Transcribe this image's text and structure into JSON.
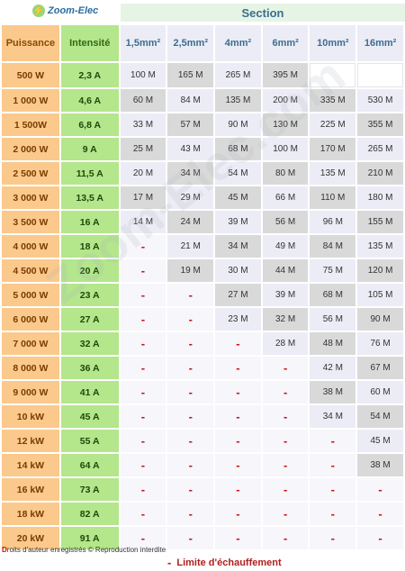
{
  "brand": {
    "logo_text": "Zoom-Elec"
  },
  "section_title": "Section",
  "headers": {
    "puissance": "Puissance",
    "intensite": "Intensité",
    "sections": [
      "1,5mm²",
      "2,5mm²",
      "4mm²",
      "6mm²",
      "10mm²",
      "16mm²"
    ]
  },
  "rows": [
    {
      "power": "500 W",
      "current": "2,3 A",
      "cells": [
        "100 M",
        "165 M",
        "265 M",
        "395 M",
        "",
        ""
      ]
    },
    {
      "power": "1 000 W",
      "current": "4,6 A",
      "cells": [
        "60 M",
        "84 M",
        "135 M",
        "200 M",
        "335 M",
        "530 M"
      ]
    },
    {
      "power": "1 500W",
      "current": "6,8 A",
      "cells": [
        "33 M",
        "57 M",
        "90 M",
        "130 M",
        "225 M",
        "355 M"
      ]
    },
    {
      "power": "2 000 W",
      "current": "9 A",
      "cells": [
        "25 M",
        "43 M",
        "68 M",
        "100 M",
        "170 M",
        "265 M"
      ]
    },
    {
      "power": "2 500 W",
      "current": "11,5 A",
      "cells": [
        "20 M",
        "34 M",
        "54 M",
        "80 M",
        "135 M",
        "210 M"
      ]
    },
    {
      "power": "3 000 W",
      "current": "13,5 A",
      "cells": [
        "17 M",
        "29 M",
        "45 M",
        "66 M",
        "110 M",
        "180 M"
      ]
    },
    {
      "power": "3 500 W",
      "current": "16 A",
      "cells": [
        "14 M",
        "24 M",
        "39 M",
        "56 M",
        "96 M",
        "155 M"
      ]
    },
    {
      "power": "4 000 W",
      "current": "18 A",
      "cells": [
        "-",
        "21 M",
        "34 M",
        "49 M",
        "84 M",
        "135 M"
      ]
    },
    {
      "power": "4 500 W",
      "current": "20 A",
      "cells": [
        "-",
        "19 M",
        "30 M",
        "44 M",
        "75 M",
        "120 M"
      ]
    },
    {
      "power": "5 000 W",
      "current": "23 A",
      "cells": [
        "-",
        "-",
        "27 M",
        "39 M",
        "68 M",
        "105 M"
      ]
    },
    {
      "power": "6 000 W",
      "current": "27 A",
      "cells": [
        "-",
        "-",
        "23 M",
        "32 M",
        "56 M",
        "90 M"
      ]
    },
    {
      "power": "7 000 W",
      "current": "32 A",
      "cells": [
        "-",
        "-",
        "-",
        "28 M",
        "48 M",
        "76 M"
      ]
    },
    {
      "power": "8 000 W",
      "current": "36 A",
      "cells": [
        "-",
        "-",
        "-",
        "-",
        "42 M",
        "67 M"
      ]
    },
    {
      "power": "9 000 W",
      "current": "41 A",
      "cells": [
        "-",
        "-",
        "-",
        "-",
        "38 M",
        "60 M"
      ]
    },
    {
      "power": "10 kW",
      "current": "45 A",
      "cells": [
        "-",
        "-",
        "-",
        "-",
        "34 M",
        "54 M"
      ]
    },
    {
      "power": "12 kW",
      "current": "55 A",
      "cells": [
        "-",
        "-",
        "-",
        "-",
        "-",
        "45 M"
      ]
    },
    {
      "power": "14 kW",
      "current": "64 A",
      "cells": [
        "-",
        "-",
        "-",
        "-",
        "-",
        "38 M"
      ]
    },
    {
      "power": "16 kW",
      "current": "73 A",
      "cells": [
        "-",
        "-",
        "-",
        "-",
        "-",
        "-"
      ]
    },
    {
      "power": "18 kW",
      "current": "82 A",
      "cells": [
        "-",
        "-",
        "-",
        "-",
        "-",
        "-"
      ]
    },
    {
      "power": "20 kW",
      "current": "91 A",
      "cells": [
        "-",
        "-",
        "-",
        "-",
        "-",
        "-"
      ]
    }
  ],
  "watermark_text": "Zoom-Elec.com",
  "copyright": {
    "first_letter": "D",
    "rest": "roits d'auteur enregistrés © Reproduction interdite"
  },
  "legend": {
    "symbol": "-",
    "label": "Limite d'échauffement"
  },
  "colors": {
    "power_col": "#fbc98c",
    "current_col": "#b4e68c",
    "value_dark": "#d9d9d9",
    "value_light": "#ececf6",
    "limit_dash": "#c81414"
  }
}
